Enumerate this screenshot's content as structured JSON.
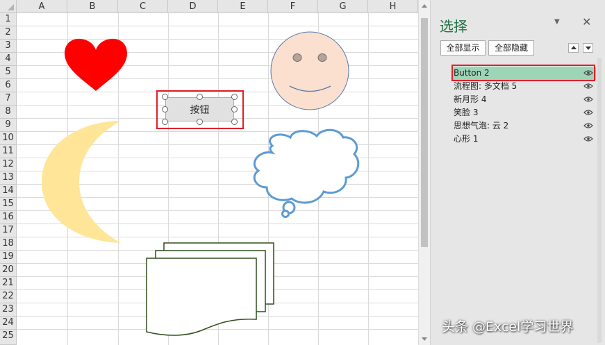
{
  "sheet": {
    "columns": [
      "A",
      "B",
      "C",
      "D",
      "E",
      "F",
      "G",
      "H"
    ],
    "rows": [
      "1",
      "2",
      "3",
      "4",
      "5",
      "6",
      "7",
      "8",
      "9",
      "10",
      "11",
      "12",
      "13",
      "14",
      "15",
      "16",
      "17",
      "18",
      "19",
      "20",
      "21",
      "22",
      "23",
      "24",
      "25"
    ],
    "button_label": "按钮"
  },
  "shapes": {
    "heart_color": "#ff0000",
    "face_fill": "#fbe0cf",
    "face_stroke": "#5b78a8",
    "moon_fill": "#ffe598",
    "cloud_stroke": "#5b9bd5",
    "documents_stroke": "#2f4f1f"
  },
  "panel": {
    "title": "选择",
    "dropdown_icon": "chevron-down-icon",
    "close_icon": "close-icon",
    "show_all_label": "全部显示",
    "hide_all_label": "全部隐藏",
    "items": [
      {
        "label": "Button 2",
        "selected": true
      },
      {
        "label": "流程图: 多文档 5",
        "selected": false
      },
      {
        "label": "新月形 4",
        "selected": false
      },
      {
        "label": "笑脸 3",
        "selected": false
      },
      {
        "label": "思想气泡: 云 2",
        "selected": false
      },
      {
        "label": "心形 1",
        "selected": false
      }
    ]
  },
  "colors": {
    "accent": "#217346",
    "selection": "#9fd5b7",
    "highlight": "#e0202a"
  },
  "watermark": "头条 @Excel学习世界"
}
